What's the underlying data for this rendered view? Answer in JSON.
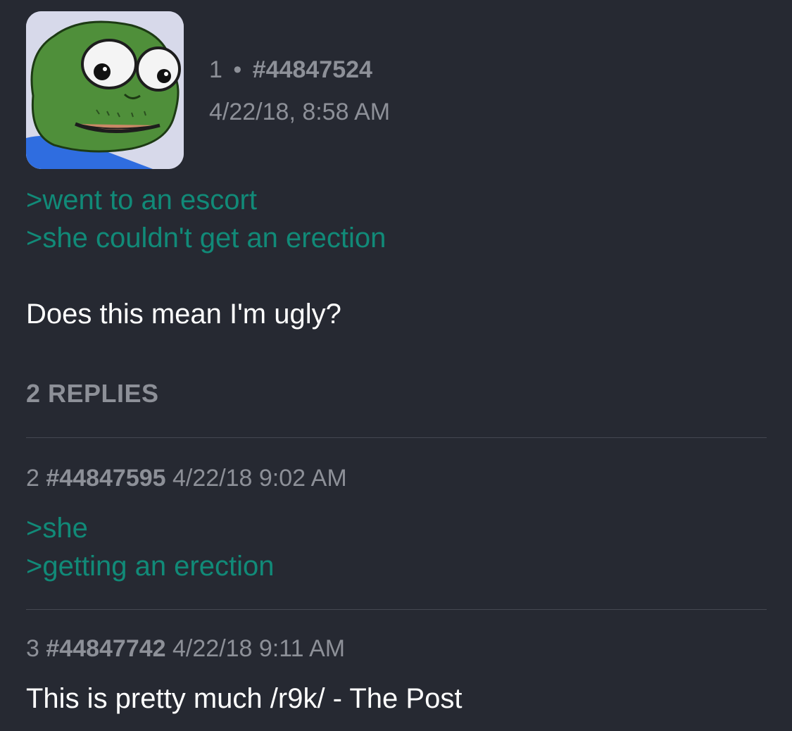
{
  "op": {
    "number": "1",
    "separator": "•",
    "post_id": "#44847524",
    "timestamp": "4/22/18, 8:58 AM",
    "greentext": [
      ">went to an escort",
      ">she couldn't get an erection"
    ],
    "body": "Does this mean I'm ugly?",
    "avatar_icon": "pepe-frog-avatar"
  },
  "replies_count_label": "2 REPLIES",
  "replies": [
    {
      "number": "2",
      "post_id": "#44847595",
      "timestamp": "4/22/18 9:02 AM",
      "greentext": [
        ">she",
        ">getting an erection"
      ]
    },
    {
      "number": "3",
      "post_id": "#44847742",
      "timestamp": "4/22/18 9:11 AM",
      "body": "This is pretty much /r9k/ - The Post"
    }
  ],
  "colors": {
    "background": "#262932",
    "greentext": "#118a78",
    "meta": "#8d9098",
    "body": "#ffffff"
  }
}
